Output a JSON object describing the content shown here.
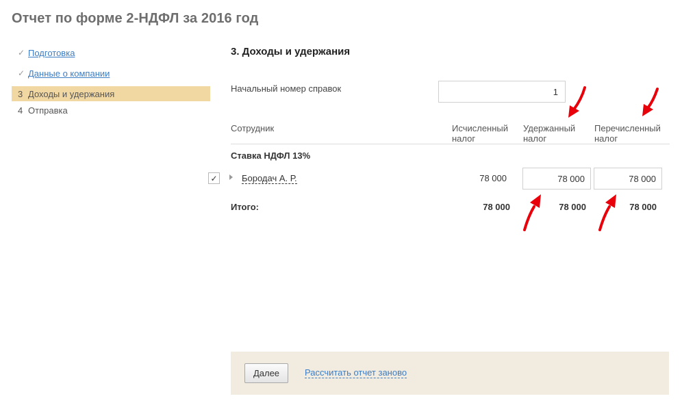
{
  "page": {
    "title": "Отчет по форме 2-НДФЛ за 2016 год"
  },
  "steps": [
    {
      "mark": "✓",
      "label": "Подготовка"
    },
    {
      "mark": "✓",
      "label": "Данные о компании"
    },
    {
      "num": "3",
      "label": "Доходы и удержания"
    },
    {
      "num": "4",
      "label": "Отправка"
    }
  ],
  "section": {
    "title": "3. Доходы и удержания",
    "start_number_label": "Начальный номер справок",
    "start_number_value": "1"
  },
  "table": {
    "headers": {
      "employee": "Сотрудник",
      "calc_line1": "Исчисленный",
      "calc_line2": "налог",
      "held_line1": "Удержанный",
      "held_line2": "налог",
      "paid_line1": "Перечисленный",
      "paid_line2": "налог"
    },
    "group": "Ставка НДФЛ 13%",
    "rows": [
      {
        "checked": true,
        "checkmark": "✓",
        "name": "Бородач А. Р.",
        "calculated": "78 000",
        "withheld": "78 000",
        "transferred": "78 000"
      }
    ],
    "total": {
      "label": "Итого:",
      "calculated": "78 000",
      "withheld": "78 000",
      "transferred": "78 000"
    }
  },
  "footer": {
    "next_label": "Далее",
    "recalc_label": "Рассчитать отчет заново"
  },
  "colors": {
    "accent_link": "#3c7dc4",
    "current_step_bg": "#f1d7a2",
    "footer_bg": "#f2ebe0",
    "annotation_arrow": "#e8000b"
  }
}
